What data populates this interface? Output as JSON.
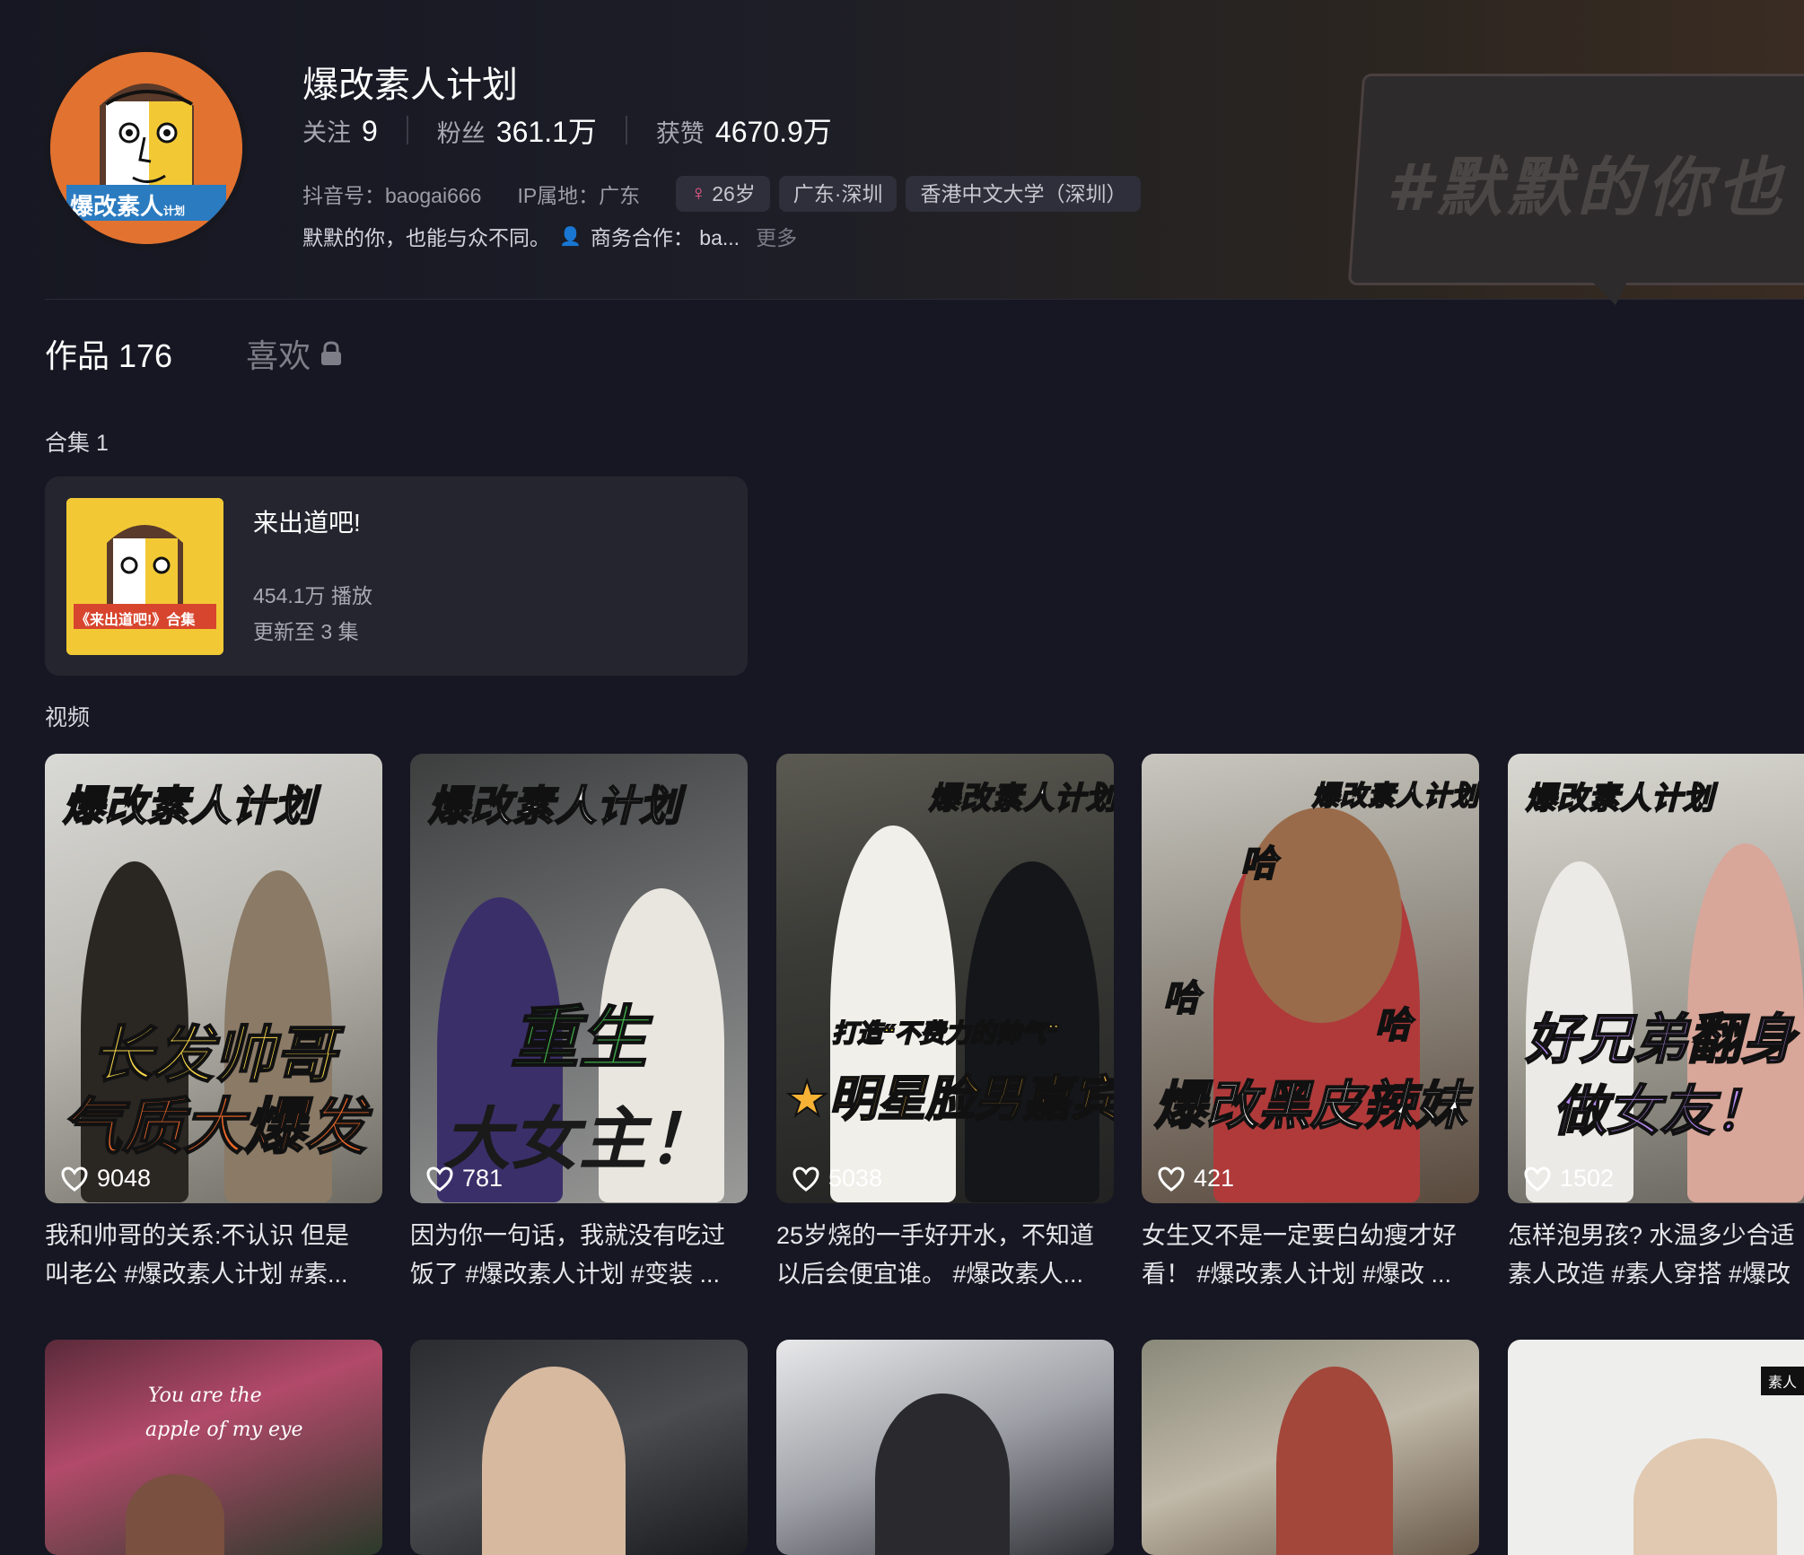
{
  "profile": {
    "name": "爆改素人计划",
    "avatar_text": "爆改素人",
    "avatar_sub": "计划",
    "stats": [
      {
        "label": "关注",
        "value": "9"
      },
      {
        "label": "粉丝",
        "value": "361.1万"
      },
      {
        "label": "获赞",
        "value": "4670.9万"
      }
    ],
    "douyin_id": "抖音号：baogai666",
    "ip": "IP属地：广东",
    "tags": [
      "26岁",
      "广东·深圳",
      "香港中文大学（深圳）"
    ],
    "bio": "默默的你，也能与众不同。",
    "business": "商务合作： ba...",
    "more": "更多",
    "banner_text": "#默默的你也"
  },
  "tabs": {
    "works": "作品 176",
    "likes": "喜欢"
  },
  "collections": {
    "label": "合集 1",
    "card": {
      "thumb_text": "《来出道吧!》合集",
      "title": "来出道吧!",
      "plays": "454.1万 播放",
      "updated": "更新至 3 集"
    }
  },
  "videos_label": "视频",
  "videos": [
    {
      "top": "爆改素人计划",
      "big1": "长发帅哥",
      "big2": "气质大爆发",
      "likes": "9048",
      "desc1": "我和帅哥的关系:不认识 但是",
      "desc2": "叫老公 #爆改素人计划 #素..."
    },
    {
      "top": "爆改素人计划",
      "big1": "重生",
      "big2": "大女主！",
      "likes": "781",
      "desc1": "因为你一句话，我就没有吃过",
      "desc2": "饭了 #爆改素人计划 #变装 ..."
    },
    {
      "top": "爆改素人计划",
      "small": "打造“不费力的帅气”",
      "big1": "★明星脸男嘉宾",
      "likes": "5038",
      "desc1": "25岁烧的一手好开水，不知道",
      "desc2": "以后会便宜谁。 #爆改素人..."
    },
    {
      "top": "爆改素人计划",
      "side1": "哈",
      "side2": "哈",
      "side3": "哈",
      "big1": "爆改黑皮辣妹",
      "likes": "421",
      "desc1": "女生又不是一定要白幼瘦才好",
      "desc2": "看！ #爆改素人计划 #爆改 ..."
    },
    {
      "top": "爆改素人计划",
      "big1": "好兄弟翻身",
      "big2": "做女友！",
      "likes": "1502",
      "desc1": "怎样泡男孩? 水温多少合适",
      "desc2": "素人改造 #素人穿搭 #爆改"
    }
  ],
  "row2": [
    {
      "text1": "You are the",
      "text2": "apple of my eye"
    },
    {},
    {},
    {},
    {
      "badge": "素人"
    }
  ]
}
